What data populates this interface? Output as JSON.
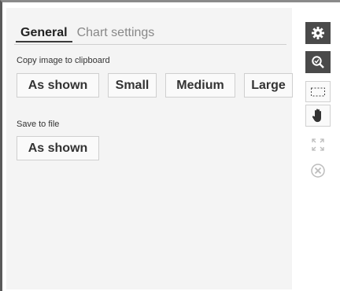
{
  "tabs": {
    "general": "General",
    "chart_settings": "Chart settings"
  },
  "copy_section": {
    "label": "Copy image to clipboard",
    "buttons": [
      "As shown",
      "Small",
      "Medium",
      "Large"
    ]
  },
  "save_section": {
    "label": "Save to file",
    "buttons": [
      "As shown"
    ]
  },
  "toolbar": {
    "icons": [
      "gear-icon",
      "zoom-icon",
      "box-select-icon",
      "pan-hand-icon",
      "fit-icon",
      "close-circle-icon"
    ]
  },
  "colors": {
    "accent_dark": "#4a4a4a",
    "panel_bg": "#f4f4f4"
  }
}
